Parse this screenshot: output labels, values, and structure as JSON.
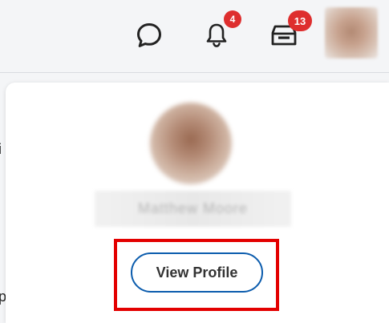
{
  "header": {
    "chat_icon": "chat-bubble-icon",
    "notifications_icon": "bell-icon",
    "notifications_count": "4",
    "inbox_icon": "inbox-tray-icon",
    "inbox_count": "13",
    "avatar": "user-avatar-blurred"
  },
  "left_edge": {
    "text_1": "i",
    "text_2": "p"
  },
  "profile_card": {
    "avatar": "user-avatar-blurred",
    "name": "Matthew Moore",
    "view_profile_label": "View Profile"
  },
  "colors": {
    "badge_red": "#de2e2e",
    "button_border_blue": "#0b5cad",
    "highlight_red": "#e30000"
  }
}
